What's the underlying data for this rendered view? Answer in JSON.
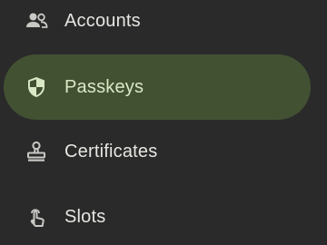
{
  "nav": {
    "items": [
      {
        "label": "Accounts",
        "icon": "people-icon",
        "selected": false
      },
      {
        "label": "Passkeys",
        "icon": "shield-icon",
        "selected": true
      },
      {
        "label": "Certificates",
        "icon": "stamp-icon",
        "selected": false
      },
      {
        "label": "Slots",
        "icon": "touch-icon",
        "selected": false
      }
    ]
  },
  "colors": {
    "background": "#2a2a2a",
    "selected_pill": "#435133",
    "text": "#e6e6e2",
    "selected_text": "#dbe8c6",
    "icon": "#c8c8c4"
  }
}
